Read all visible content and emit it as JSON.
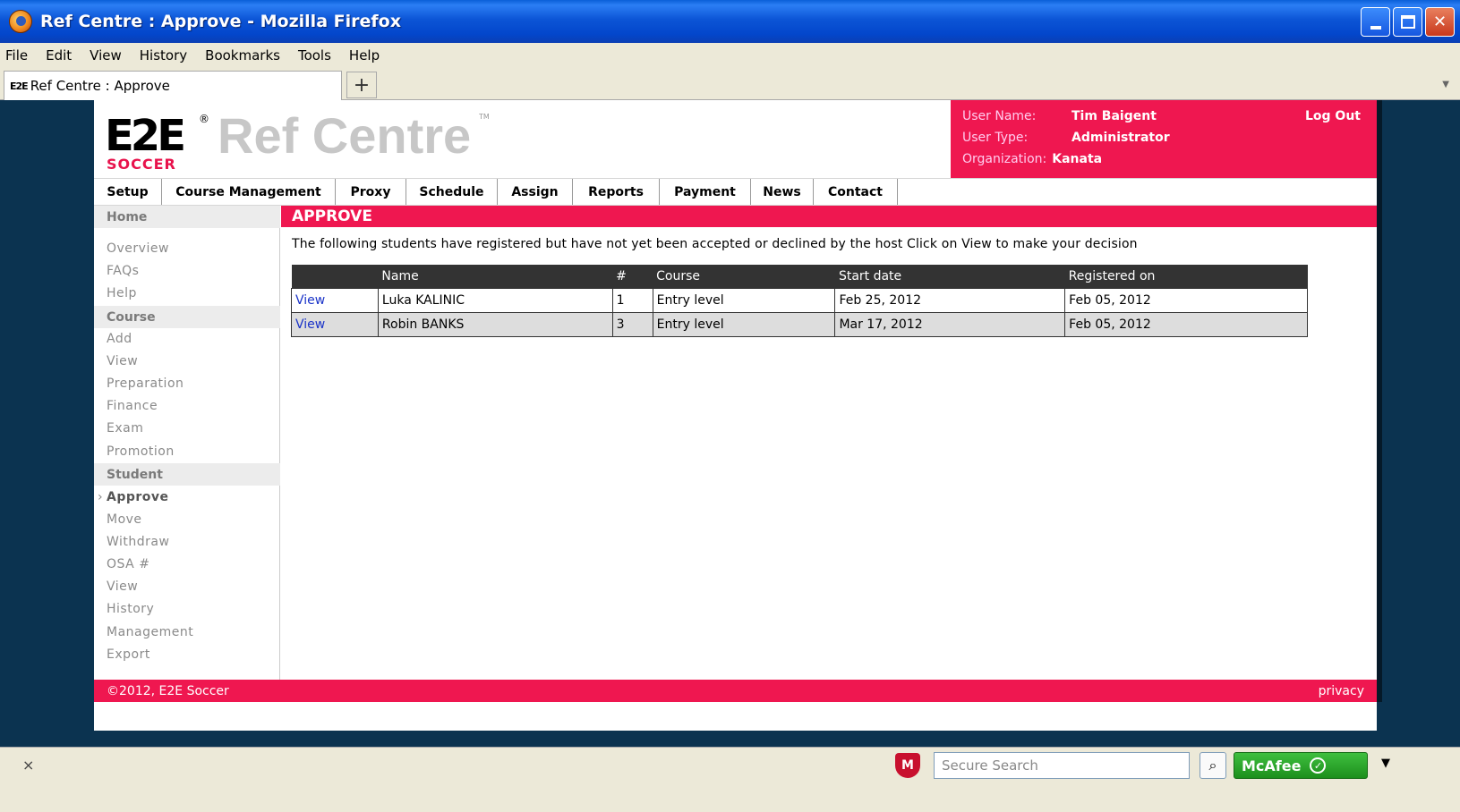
{
  "window": {
    "title": "Ref Centre : Approve - Mozilla Firefox"
  },
  "menubar": [
    "File",
    "Edit",
    "View",
    "History",
    "Bookmarks",
    "Tools",
    "Help"
  ],
  "tab": {
    "favicon": "E2E",
    "label": "Ref Centre : Approve",
    "new_tab": "+"
  },
  "header": {
    "logo_main": "E2E",
    "logo_sub": "SOCCER",
    "logo_reg": "®",
    "brand": "Ref Centre",
    "tm": "TM",
    "user": {
      "name_label": "User Name:",
      "name_value": "Tim Baigent",
      "type_label": "User Type:",
      "type_value": "Administrator",
      "org_label": "Organization:",
      "org_value": "Kanata",
      "logout": "Log Out"
    }
  },
  "nav": [
    "Setup",
    "Course Management",
    "Proxy",
    "Schedule",
    "Assign",
    "Reports",
    "Payment",
    "News",
    "Contact"
  ],
  "sidebar": {
    "home": "Home",
    "general": [
      "Overview",
      "FAQs",
      "Help"
    ],
    "course_title": "Course",
    "course": [
      "Add",
      "View",
      "Preparation",
      "Finance",
      "Exam",
      "Promotion"
    ],
    "student_title": "Student",
    "student": [
      "Approve",
      "Move",
      "Withdraw",
      "OSA #",
      "View",
      "History",
      "Management",
      "Export"
    ],
    "active": "Approve"
  },
  "main": {
    "heading": "APPROVE",
    "intro": "The following students have registered but have not yet been accepted or declined by the host Click on View to make your decision",
    "columns": [
      "",
      "Name",
      "#",
      "Course",
      "Start date",
      "Registered on"
    ],
    "rows": [
      [
        "View",
        "Luka KALINIC",
        "1",
        "Entry level",
        "Feb 25, 2012",
        "Feb 05, 2012"
      ],
      [
        "View",
        "Robin BANKS",
        "3",
        "Entry level",
        "Mar 17, 2012",
        "Feb 05, 2012"
      ]
    ]
  },
  "footer": {
    "copyright": "©2012, E2E Soccer",
    "privacy": "privacy"
  },
  "statusbar": {
    "close": "×",
    "search_placeholder": "Secure Search",
    "mcafee": "McAfee"
  },
  "colors": {
    "accent": "#ef1750",
    "page_bg": "#0b3350",
    "link": "#1a33c8"
  }
}
